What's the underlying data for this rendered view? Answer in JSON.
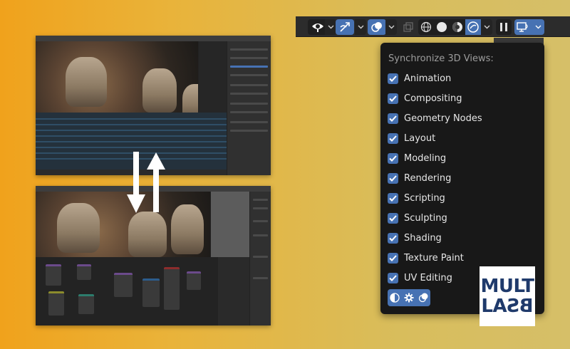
{
  "popup": {
    "title": "Synchronize 3D Views:",
    "options": [
      {
        "label": "Animation",
        "checked": true
      },
      {
        "label": "Compositing",
        "checked": true
      },
      {
        "label": "Geometry Nodes",
        "checked": true
      },
      {
        "label": "Layout",
        "checked": true
      },
      {
        "label": "Modeling",
        "checked": true
      },
      {
        "label": "Rendering",
        "checked": true
      },
      {
        "label": "Scripting",
        "checked": true
      },
      {
        "label": "Sculpting",
        "checked": true
      },
      {
        "label": "Shading",
        "checked": true
      },
      {
        "label": "Texture Paint",
        "checked": true
      },
      {
        "label": "UV Editing",
        "checked": true
      }
    ],
    "footer_icons": [
      "shading-icon",
      "gear-icon",
      "render-icon"
    ]
  },
  "toolbar": {
    "icons": [
      "visibility-icon",
      "gizmo-icon",
      "overlay-icon",
      "xray-icon",
      "wireframe-shading-icon",
      "solid-shading-icon",
      "material-shading-icon",
      "rendered-shading-icon",
      "pause-icon",
      "sync-views-icon"
    ]
  },
  "logo": {
    "line1": "MULT",
    "line2": "LA",
    "line2_mirrored": "BS"
  },
  "colors": {
    "accent": "#4772b3",
    "popup_bg": "#181818",
    "toolbar_bg": "#2c2c2c",
    "logo_text": "#1f3a6b"
  }
}
